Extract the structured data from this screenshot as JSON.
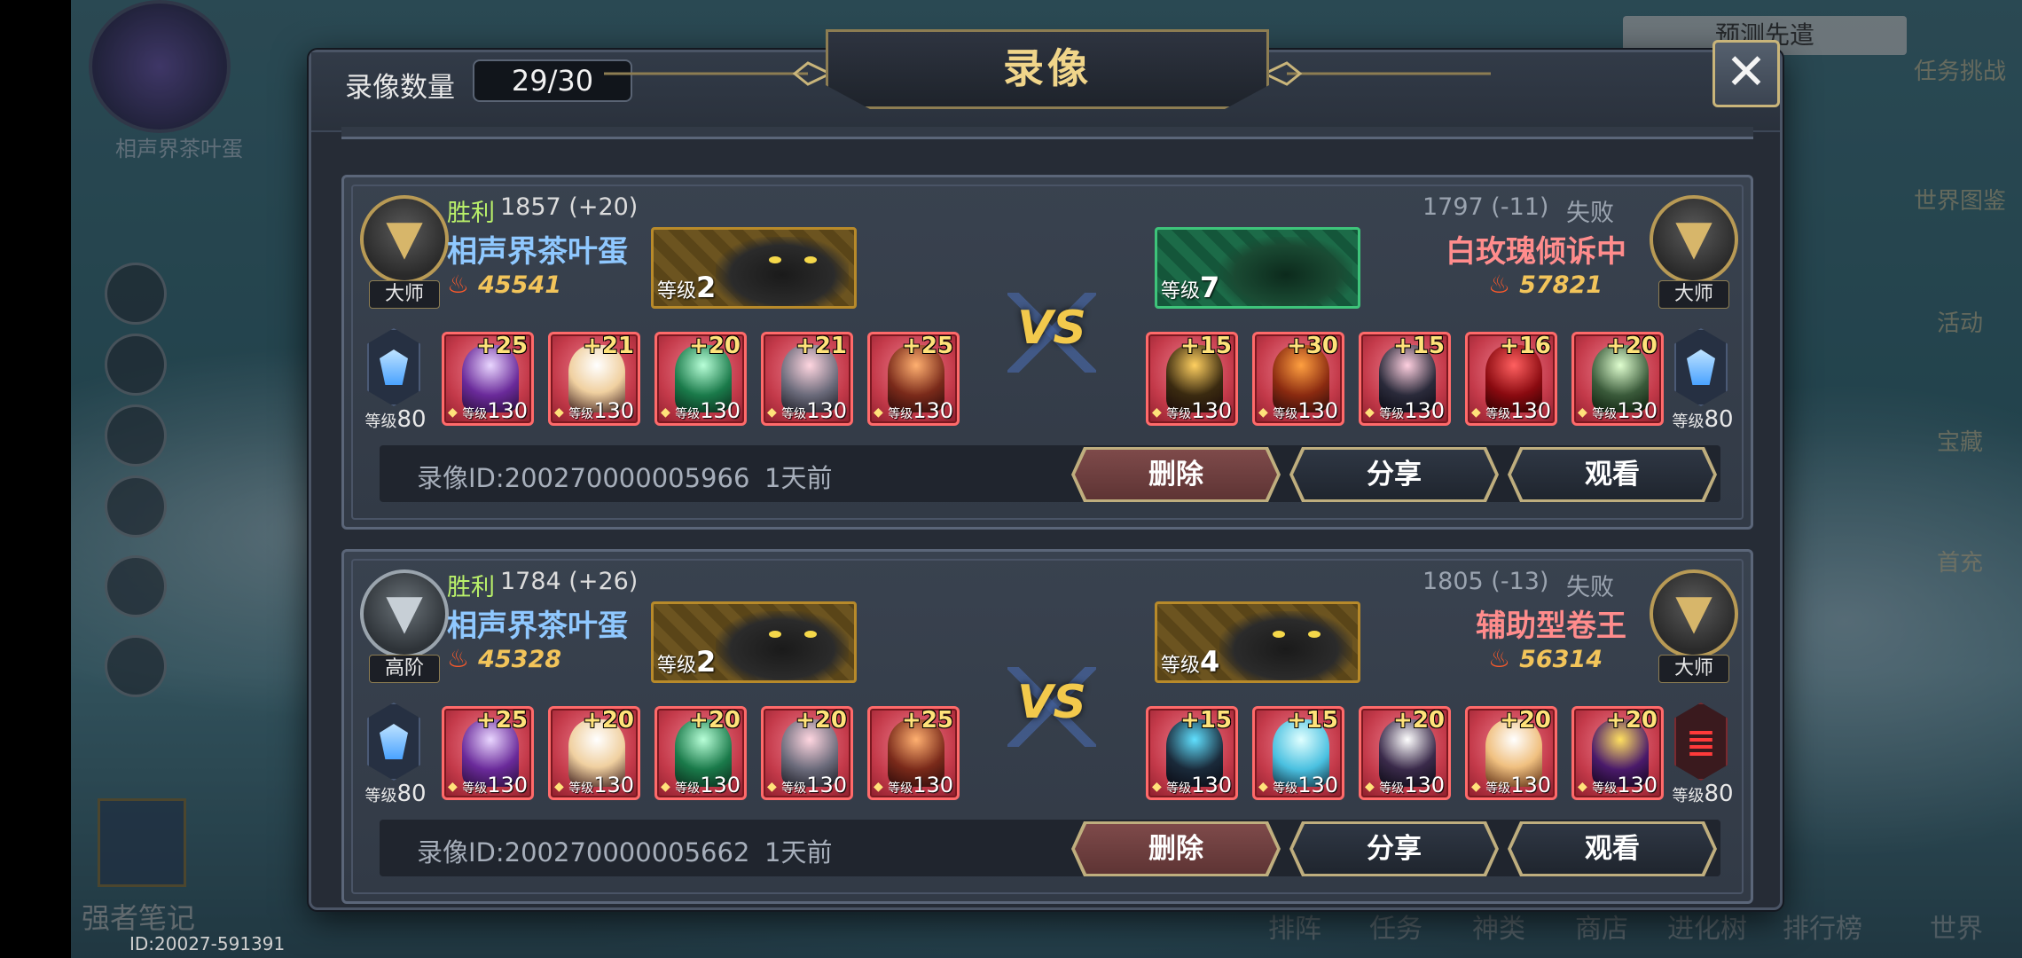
{
  "background": {
    "player_id": "ID:20027-591391",
    "avatar_name": "相声界茶叶蛋",
    "top_right_button": "预测先遣",
    "left_bottom_label": "强者笔记",
    "bottom_nav": [
      "排阵",
      "任务",
      "神类",
      "商店",
      "进化树",
      "排行榜",
      "世界"
    ],
    "right_menu": [
      "任务挑战",
      "世界图鉴",
      "活动",
      "宝藏",
      "首充"
    ]
  },
  "modal": {
    "count_label": "录像数量",
    "count_value": "29/30",
    "title": "录像",
    "close_label": "✕"
  },
  "records": [
    {
      "left": {
        "result": "胜利",
        "score": "1857 (+20)",
        "name": "相声界茶叶蛋",
        "power": "45541",
        "rank": "大师",
        "rank_style": "gold",
        "pet_level_label": "等级",
        "pet_level": "2",
        "pet_style": "gold",
        "badge_level_label": "等级",
        "badge_level": "80",
        "badge_style": "blue",
        "heroes": [
          {
            "plus": "+25",
            "level_label": "等级",
            "level": "130"
          },
          {
            "plus": "+21",
            "level_label": "等级",
            "level": "130"
          },
          {
            "plus": "+20",
            "level_label": "等级",
            "level": "130"
          },
          {
            "plus": "+21",
            "level_label": "等级",
            "level": "130"
          },
          {
            "plus": "+25",
            "level_label": "等级",
            "level": "130"
          }
        ]
      },
      "right": {
        "result": "失败",
        "score": "1797 (-11)",
        "name": "白玫瑰倾诉中",
        "power": "57821",
        "rank": "大师",
        "rank_style": "gold",
        "pet_level_label": "等级",
        "pet_level": "7",
        "pet_style": "green",
        "badge_level_label": "等级",
        "badge_level": "80",
        "badge_style": "blue",
        "heroes": [
          {
            "plus": "+15",
            "level_label": "等级",
            "level": "130"
          },
          {
            "plus": "+30",
            "level_label": "等级",
            "level": "130"
          },
          {
            "plus": "+15",
            "level_label": "等级",
            "level": "130"
          },
          {
            "plus": "+16",
            "level_label": "等级",
            "level": "130"
          },
          {
            "plus": "+20",
            "level_label": "等级",
            "level": "130"
          }
        ]
      },
      "vs": "VS",
      "record_id": "录像ID:200270000005966",
      "time_ago": "1天前",
      "delete_label": "删除",
      "share_label": "分享",
      "watch_label": "观看"
    },
    {
      "left": {
        "result": "胜利",
        "score": "1784 (+26)",
        "name": "相声界茶叶蛋",
        "power": "45328",
        "rank": "高阶",
        "rank_style": "silver",
        "pet_level_label": "等级",
        "pet_level": "2",
        "pet_style": "gold",
        "badge_level_label": "等级",
        "badge_level": "80",
        "badge_style": "blue",
        "heroes": [
          {
            "plus": "+25",
            "level_label": "等级",
            "level": "130"
          },
          {
            "plus": "+20",
            "level_label": "等级",
            "level": "130"
          },
          {
            "plus": "+20",
            "level_label": "等级",
            "level": "130"
          },
          {
            "plus": "+20",
            "level_label": "等级",
            "level": "130"
          },
          {
            "plus": "+25",
            "level_label": "等级",
            "level": "130"
          }
        ]
      },
      "right": {
        "result": "失败",
        "score": "1805 (-13)",
        "name": "辅助型卷王",
        "power": "56314",
        "rank": "大师",
        "rank_style": "gold",
        "pet_level_label": "等级",
        "pet_level": "4",
        "pet_style": "gold",
        "badge_level_label": "等级",
        "badge_level": "80",
        "badge_style": "red",
        "heroes": [
          {
            "plus": "+15",
            "level_label": "等级",
            "level": "130"
          },
          {
            "plus": "+15",
            "level_label": "等级",
            "level": "130"
          },
          {
            "plus": "+20",
            "level_label": "等级",
            "level": "130"
          },
          {
            "plus": "+20",
            "level_label": "等级",
            "level": "130"
          },
          {
            "plus": "+20",
            "level_label": "等级",
            "level": "130"
          }
        ]
      },
      "vs": "VS",
      "record_id": "录像ID:200270000005662",
      "time_ago": "1天前",
      "delete_label": "删除",
      "share_label": "分享",
      "watch_label": "观看"
    }
  ],
  "colors": {
    "win": "#b9f06a",
    "lose": "#9ba4b0",
    "left_name": "#8fc8ff",
    "right_name": "#ff8c8c",
    "power": "#f2c45a",
    "title": "#f0d58a",
    "vs": "#f2c94c"
  }
}
